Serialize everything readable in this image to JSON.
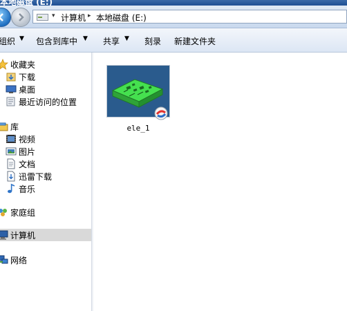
{
  "window": {
    "title": "本地磁盘 (E:)"
  },
  "address": {
    "crumbs": [
      "计算机",
      "本地磁盘 (E:)"
    ]
  },
  "toolbar": {
    "organize": "组织",
    "include_in_library": "包含到库中",
    "share": "共享",
    "burn": "刻录",
    "new_folder": "新建文件夹"
  },
  "sidebar": {
    "favorites": {
      "label": "收藏夹",
      "items": [
        "下载",
        "桌面",
        "最近访问的位置"
      ]
    },
    "libraries": {
      "label": "库",
      "items": [
        "视频",
        "图片",
        "文档",
        "迅雷下载",
        "音乐"
      ]
    },
    "homegroup": "家庭组",
    "computer": "计算机",
    "network": "网络"
  },
  "files": [
    {
      "name": "ele_1",
      "icon": "3d-model-file-icon"
    }
  ],
  "colors": {
    "accent": "#1e4f93",
    "selection": "#d9d9d9",
    "thumb_bg": "#2a5b8d",
    "model_green": "#3fd14a"
  }
}
